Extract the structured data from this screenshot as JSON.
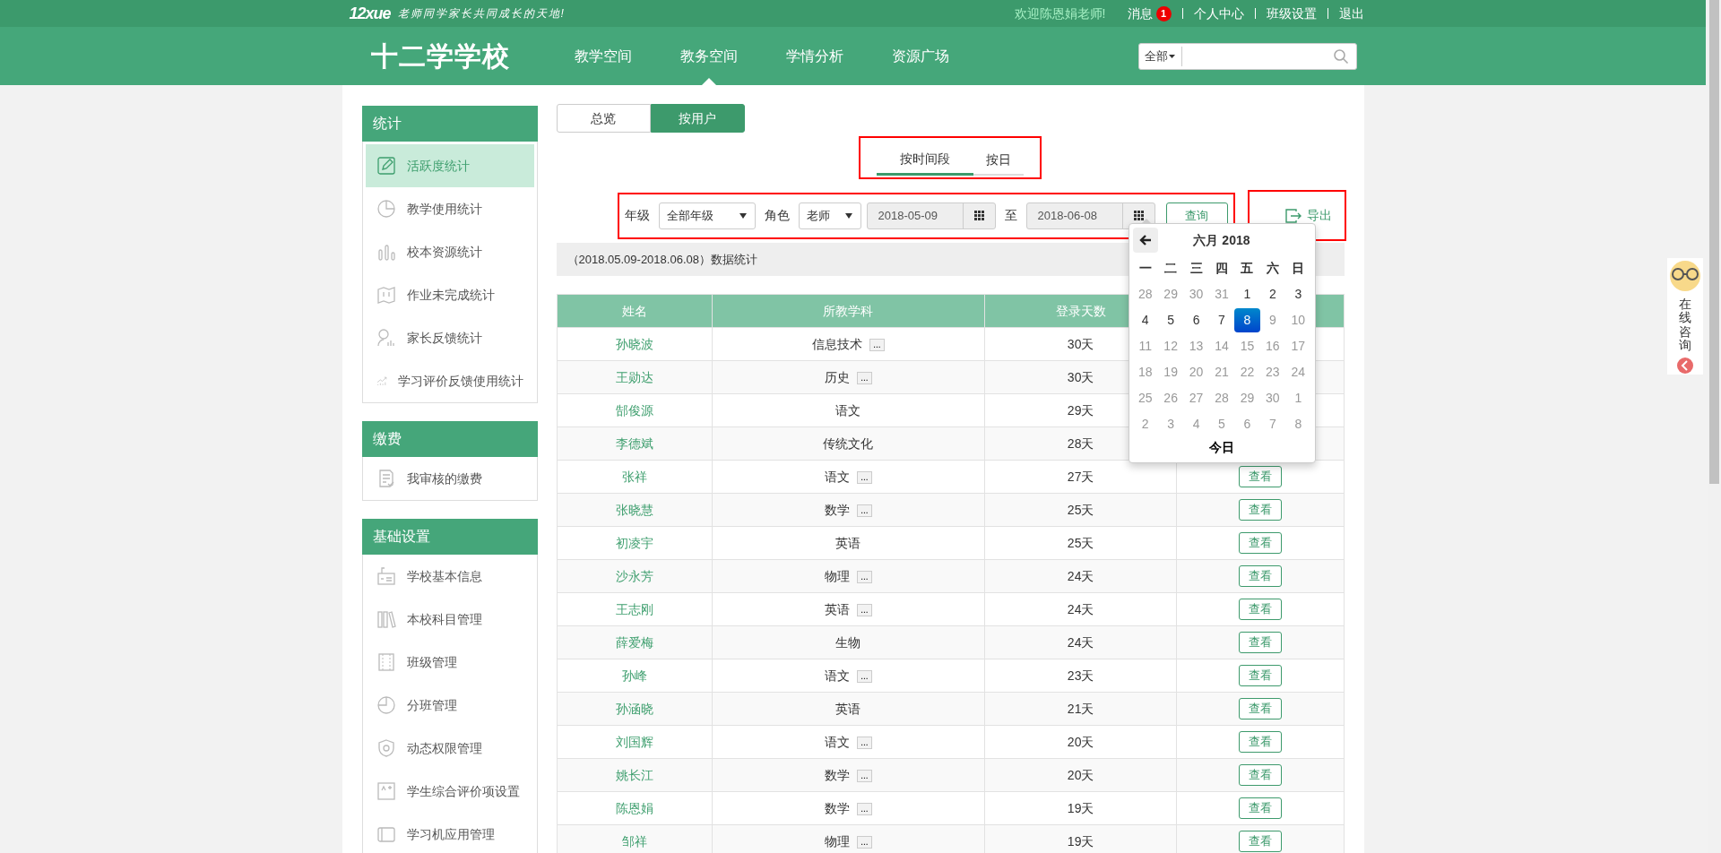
{
  "top_bar": {
    "logo": "12xue",
    "slogan": "老师同学家长共同成长的天地!",
    "welcome": "欢迎陈恩娟老师!",
    "messages": {
      "label": "消息",
      "count": "1"
    },
    "links": [
      "个人中心",
      "班级设置",
      "退出"
    ]
  },
  "nav": {
    "brand": "十二学学校",
    "items": [
      {
        "label": "教学空间",
        "selected": false
      },
      {
        "label": "教务空间",
        "selected": true
      },
      {
        "label": "学情分析",
        "selected": false
      },
      {
        "label": "资源广场",
        "selected": false
      }
    ],
    "search": {
      "scope": "全部"
    }
  },
  "sidebar": [
    {
      "title": "统计",
      "items": [
        {
          "label": "活跃度统计",
          "selected": true
        },
        {
          "label": "教学使用统计",
          "selected": false
        },
        {
          "label": "校本资源统计",
          "selected": false
        },
        {
          "label": "作业未完成统计",
          "selected": false
        },
        {
          "label": "家长反馈统计",
          "selected": false
        },
        {
          "label": "学习评价反馈使用统计",
          "selected": false
        }
      ]
    },
    {
      "title": "缴费",
      "items": [
        {
          "label": "我审核的缴费",
          "selected": false
        }
      ]
    },
    {
      "title": "基础设置",
      "items": [
        {
          "label": "学校基本信息",
          "selected": false
        },
        {
          "label": "本校科目管理",
          "selected": false
        },
        {
          "label": "班级管理",
          "selected": false
        },
        {
          "label": "分班管理",
          "selected": false
        },
        {
          "label": "动态权限管理",
          "selected": false
        },
        {
          "label": "学生综合评价项设置",
          "selected": false
        },
        {
          "label": "学习机应用管理",
          "selected": false
        }
      ]
    }
  ],
  "view_tabs": [
    {
      "label": "总览",
      "selected": false
    },
    {
      "label": "按用户",
      "selected": true
    }
  ],
  "sub_tabs": {
    "highlighted": true,
    "items": [
      {
        "label": "按时间段",
        "selected": true
      },
      {
        "label": "按日",
        "selected": false
      }
    ]
  },
  "filters": {
    "highlighted": true,
    "grade_label": "年级",
    "grade": "全部年级",
    "role_label": "角色",
    "role": "老师",
    "start_date": "2018-05-09",
    "to_label": "至",
    "end_date": "2018-06-08",
    "query_button": "查询"
  },
  "export": {
    "highlighted": true,
    "label": "导出"
  },
  "summary": "（2018.05.09-2018.06.08）数据统计",
  "table": {
    "columns": [
      "姓名",
      "所教学科",
      "登录天数"
    ],
    "rows": [
      {
        "name": "孙晓波",
        "subject": "信息技术",
        "more": "...",
        "days": "30天"
      },
      {
        "name": "王勋达",
        "subject": "历史",
        "more": "...",
        "days": "30天"
      },
      {
        "name": "郜俊源",
        "subject": "语文",
        "days": "29天"
      },
      {
        "name": "李德斌",
        "subject": "传统文化",
        "days": "28天"
      },
      {
        "name": "张祥",
        "subject": "语文",
        "more": "...",
        "days": "27天",
        "action": "查看"
      },
      {
        "name": "张晓慧",
        "subject": "数学",
        "more": "...",
        "days": "25天",
        "action": "查看"
      },
      {
        "name": "初凌宇",
        "subject": "英语",
        "days": "25天",
        "action": "查看"
      },
      {
        "name": "沙永芳",
        "subject": "物理",
        "more": "...",
        "days": "24天",
        "action": "查看"
      },
      {
        "name": "王志刚",
        "subject": "英语",
        "more": "...",
        "days": "24天",
        "action": "查看"
      },
      {
        "name": "薛爱梅",
        "subject": "生物",
        "days": "24天",
        "action": "查看"
      },
      {
        "name": "孙峰",
        "subject": "语文",
        "more": "...",
        "days": "23天",
        "action": "查看"
      },
      {
        "name": "孙涵晓",
        "subject": "英语",
        "days": "21天",
        "action": "查看"
      },
      {
        "name": "刘国辉",
        "subject": "语文",
        "more": "...",
        "days": "20天",
        "action": "查看"
      },
      {
        "name": "姚长江",
        "subject": "数学",
        "more": "...",
        "days": "20天",
        "action": "查看"
      },
      {
        "name": "陈恩娟",
        "subject": "数学",
        "more": "...",
        "days": "19天",
        "action": "查看"
      },
      {
        "name": "邹祥",
        "subject": "物理",
        "more": "...",
        "days": "19天",
        "action": "查看"
      }
    ]
  },
  "calendar": {
    "title": "六月 2018",
    "weekdays": [
      "一",
      "二",
      "三",
      "四",
      "五",
      "六",
      "日"
    ],
    "days": [
      {
        "label": "28",
        "disabled": true,
        "selected": false
      },
      {
        "label": "29",
        "disabled": true,
        "selected": false
      },
      {
        "label": "30",
        "disabled": true,
        "selected": false
      },
      {
        "label": "31",
        "disabled": true,
        "selected": false
      },
      {
        "label": "1",
        "disabled": false,
        "selected": false
      },
      {
        "label": "2",
        "disabled": false,
        "selected": false
      },
      {
        "label": "3",
        "disabled": false,
        "selected": false
      },
      {
        "label": "4",
        "disabled": false,
        "selected": false
      },
      {
        "label": "5",
        "disabled": false,
        "selected": false
      },
      {
        "label": "6",
        "disabled": false,
        "selected": false
      },
      {
        "label": "7",
        "disabled": false,
        "selected": false
      },
      {
        "label": "8",
        "disabled": false,
        "selected": true
      },
      {
        "label": "9",
        "disabled": true,
        "selected": false
      },
      {
        "label": "10",
        "disabled": true,
        "selected": false
      },
      {
        "label": "11",
        "disabled": true,
        "selected": false
      },
      {
        "label": "12",
        "disabled": true,
        "selected": false
      },
      {
        "label": "13",
        "disabled": true,
        "selected": false
      },
      {
        "label": "14",
        "disabled": true,
        "selected": false
      },
      {
        "label": "15",
        "disabled": true,
        "selected": false
      },
      {
        "label": "16",
        "disabled": true,
        "selected": false
      },
      {
        "label": "17",
        "disabled": true,
        "selected": false
      },
      {
        "label": "18",
        "disabled": true,
        "selected": false
      },
      {
        "label": "19",
        "disabled": true,
        "selected": false
      },
      {
        "label": "20",
        "disabled": true,
        "selected": false
      },
      {
        "label": "21",
        "disabled": true,
        "selected": false
      },
      {
        "label": "22",
        "disabled": true,
        "selected": false
      },
      {
        "label": "23",
        "disabled": true,
        "selected": false
      },
      {
        "label": "24",
        "disabled": true,
        "selected": false
      },
      {
        "label": "25",
        "disabled": true,
        "selected": false
      },
      {
        "label": "26",
        "disabled": true,
        "selected": false
      },
      {
        "label": "27",
        "disabled": true,
        "selected": false
      },
      {
        "label": "28",
        "disabled": true,
        "selected": false
      },
      {
        "label": "29",
        "disabled": true,
        "selected": false
      },
      {
        "label": "30",
        "disabled": true,
        "selected": false
      },
      {
        "label": "1",
        "disabled": true,
        "selected": false
      },
      {
        "label": "2",
        "disabled": true,
        "selected": false
      },
      {
        "label": "3",
        "disabled": true,
        "selected": false
      },
      {
        "label": "4",
        "disabled": true,
        "selected": false
      },
      {
        "label": "5",
        "disabled": true,
        "selected": false
      },
      {
        "label": "6",
        "disabled": true,
        "selected": false
      },
      {
        "label": "7",
        "disabled": true,
        "selected": false
      },
      {
        "label": "8",
        "disabled": true,
        "selected": false
      }
    ],
    "today": "今日"
  },
  "consult_widget": {
    "label": "在线咨询"
  }
}
